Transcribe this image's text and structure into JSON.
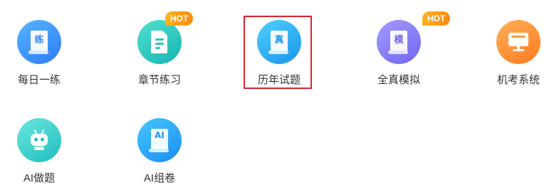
{
  "items": [
    {
      "label": "每日一练",
      "icon": "practice-book-icon",
      "glyph": "练",
      "glyph_color": "#3b86f5",
      "hot": false
    },
    {
      "label": "章节练习",
      "icon": "chapter-document-icon",
      "glyph": "",
      "hot": true,
      "hot_label": "HOT"
    },
    {
      "label": "历年试题",
      "icon": "past-exam-book-icon",
      "glyph": "真",
      "glyph_color": "#1f9bef",
      "hot": false,
      "selected": true
    },
    {
      "label": "全真模拟",
      "icon": "mock-exam-book-icon",
      "glyph": "模",
      "glyph_color": "#6f66f0",
      "hot": true,
      "hot_label": "HOT"
    },
    {
      "label": "机考系统",
      "icon": "computer-monitor-icon",
      "glyph": "",
      "hot": false
    },
    {
      "label": "AI做题",
      "icon": "robot-icon",
      "glyph": "",
      "hot": false
    },
    {
      "label": "AI组卷",
      "icon": "ai-paper-book-icon",
      "glyph": "AI",
      "glyph_color": "#1f93ef",
      "hot": false
    }
  ],
  "colors": {
    "selection_border": "#d9232d",
    "hot_badge": "#ff9a15",
    "label_text": "#333333"
  }
}
